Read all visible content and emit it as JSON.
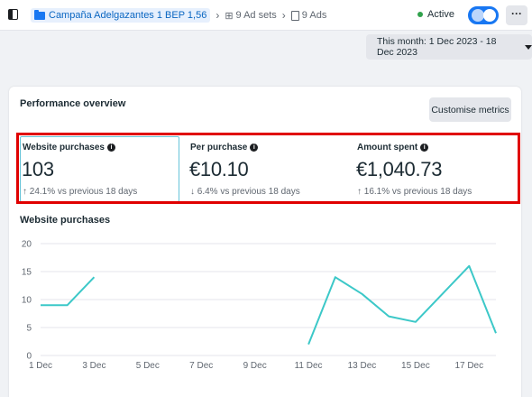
{
  "breadcrumb": {
    "campaign": "Campaña Adelgazantes 1 BEP 1,56",
    "ad_sets": "9 Ad sets",
    "ads": "9 Ads"
  },
  "status": {
    "label": "Active",
    "toggle_on": true
  },
  "date_range": "This month: 1 Dec 2023 - 18 Dec 2023",
  "card": {
    "title": "Performance overview",
    "customise_label": "Customise metrics"
  },
  "metrics": [
    {
      "label": "Website purchases",
      "value": "103",
      "trend": "↑ 24.1% vs previous 18 days"
    },
    {
      "label": "Per purchase",
      "value": "€10.10",
      "trend": "↓ 6.4% vs previous 18 days"
    },
    {
      "label": "Amount spent",
      "value": "€1,040.73",
      "trend": "↑ 16.1% vs previous 18 days"
    }
  ],
  "colors": {
    "accent": "#1877f2",
    "line": "#3cc8c8",
    "highlight_box": "#e00000"
  },
  "chart_data": {
    "type": "line",
    "title": "Website purchases",
    "xlabel": "",
    "ylabel": "",
    "ylim": [
      0,
      20
    ],
    "y_ticks": [
      "0",
      "5",
      "10",
      "15",
      "20"
    ],
    "x_tick_labels": [
      "1 Dec",
      "3 Dec",
      "5 Dec",
      "7 Dec",
      "9 Dec",
      "11 Dec",
      "13 Dec",
      "15 Dec",
      "17 Dec"
    ],
    "x_tick_days": [
      1,
      3,
      5,
      7,
      9,
      11,
      13,
      15,
      17
    ],
    "x_domain": [
      1,
      18
    ],
    "grid": true,
    "series": [
      {
        "segments": [
          [
            [
              1,
              9
            ],
            [
              2,
              9
            ],
            [
              3,
              14
            ]
          ],
          [
            [
              11,
              2
            ],
            [
              12,
              14
            ],
            [
              13,
              11
            ],
            [
              14,
              7
            ],
            [
              15,
              6
            ],
            [
              16,
              11
            ],
            [
              17,
              16
            ],
            [
              18,
              4
            ]
          ]
        ]
      }
    ]
  }
}
